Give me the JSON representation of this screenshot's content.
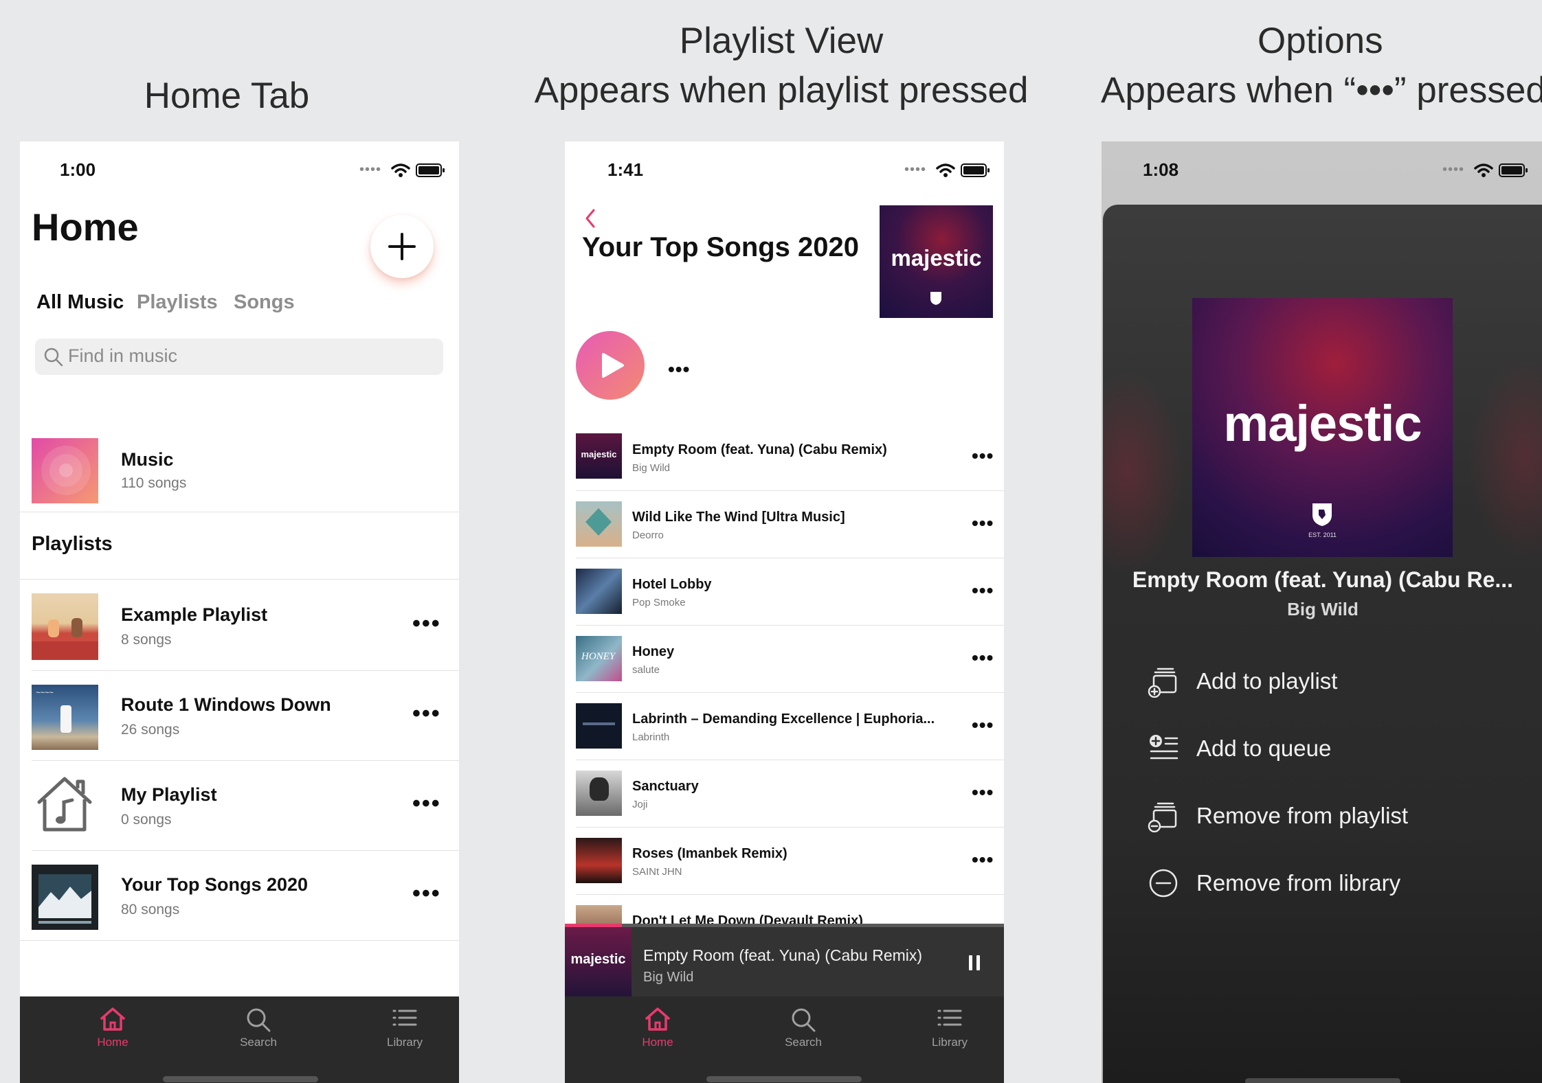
{
  "captions": {
    "home": "Home Tab",
    "playlist_title": "Playlist View",
    "playlist_sub": "Appears when playlist pressed",
    "options_title": "Options",
    "options_sub": "Appears when “•••” pressed"
  },
  "home": {
    "time": "1:00",
    "title": "Home",
    "segments": [
      "All Music",
      "Playlists",
      "Songs"
    ],
    "search_placeholder": "Find in music",
    "music": {
      "title": "Music",
      "count": "110 songs"
    },
    "playlists_header": "Playlists",
    "playlists": [
      {
        "title": "Example Playlist",
        "count": "8 songs"
      },
      {
        "title": "Route 1 Windows Down",
        "count": "26 songs"
      },
      {
        "title": "My Playlist",
        "count": "0 songs"
      },
      {
        "title": "Your Top Songs 2020",
        "count": "80 songs"
      }
    ]
  },
  "playlist": {
    "time": "1:41",
    "title": "Your Top Songs 2020",
    "cover_text": "majestic",
    "songs": [
      {
        "title": "Empty Room (feat. Yuna) (Cabu Remix)",
        "artist": "Big Wild"
      },
      {
        "title": "Wild Like The Wind  [Ultra Music]",
        "artist": "Deorro"
      },
      {
        "title": "Hotel Lobby",
        "artist": "Pop Smoke"
      },
      {
        "title": "Honey",
        "artist": "salute"
      },
      {
        "title": "Labrinth – Demanding Excellence  | Euphoria...",
        "artist": "Labrinth"
      },
      {
        "title": "Sanctuary",
        "artist": "Joji"
      },
      {
        "title": "Roses (Imanbek Remix)",
        "artist": "SAINt JHN"
      },
      {
        "title": "Don't Let Me Down (Devault Remix)",
        "artist": ""
      }
    ],
    "now_playing": {
      "title": "Empty Room (feat. Yuna) (Cabu Remix)",
      "artist": "Big Wild",
      "cover_text": "majestic"
    }
  },
  "options": {
    "time": "1:08",
    "cover_text": "majestic",
    "cover_sub": "EST. 2011",
    "song_title": "Empty Room (feat. Yuna) (Cabu Re...",
    "artist": "Big Wild",
    "items": [
      "Add to playlist",
      "Add to queue",
      "Remove from playlist",
      "Remove from library"
    ]
  },
  "tabs": {
    "home": "Home",
    "search": "Search",
    "library": "Library"
  },
  "colors": {
    "accent": "#e83a6e",
    "tabbar": "#2a2a2a",
    "sheet": "#2f2f2f"
  }
}
